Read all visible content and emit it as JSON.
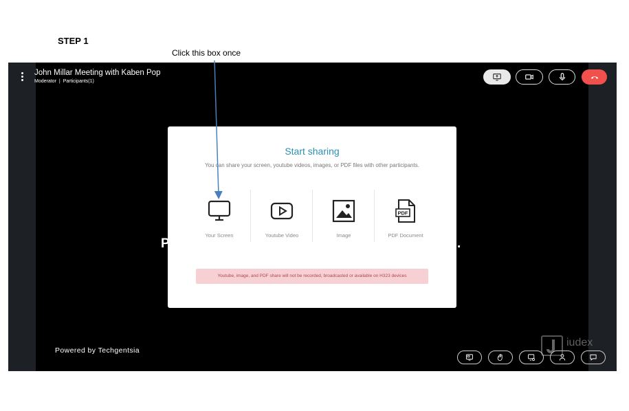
{
  "page": {
    "step_title": "STEP 1",
    "annotation": "Click this box once"
  },
  "meeting": {
    "title": "John Millar Meeting with Kaben Pop",
    "role": "Moderator",
    "separator": "|",
    "participants": "Participants(1)",
    "powered_by": "Powered by Techgentsia",
    "brand": "iudex",
    "behind_text_left": "P",
    "behind_text_right": "."
  },
  "top_controls": [
    {
      "name": "share-screen",
      "icon": "screen-share-icon"
    },
    {
      "name": "video",
      "icon": "video-camera-icon"
    },
    {
      "name": "microphone",
      "icon": "microphone-icon"
    },
    {
      "name": "end-call",
      "icon": "phone-hangup-icon"
    }
  ],
  "bottom_controls": [
    {
      "name": "layout",
      "icon": "layout-icon"
    },
    {
      "name": "raise-hand",
      "icon": "hand-icon"
    },
    {
      "name": "screen-settings",
      "icon": "screen-settings-icon"
    },
    {
      "name": "participants",
      "icon": "participants-icon"
    },
    {
      "name": "chat",
      "icon": "chat-icon"
    }
  ],
  "modal": {
    "title": "Start sharing",
    "description": "You can share your screen, youtube videos, images, or PDF files with other participants.",
    "options": [
      {
        "label": "Your Screen",
        "icon": "monitor-icon"
      },
      {
        "label": "Youtube Video",
        "icon": "play-button-icon"
      },
      {
        "label": "Image",
        "icon": "image-icon"
      },
      {
        "label": "PDF Document",
        "icon": "pdf-file-icon"
      }
    ],
    "pdf_icon_text": "PDF",
    "warning": "Youtube, image, and PDF share will not be recorded, broadcasted or available on H323 devices"
  },
  "colors": {
    "accent": "#2b8fb3",
    "end_call": "#f2504d",
    "warning_bg": "#f6d0d3",
    "warning_text": "#b04650",
    "arrow": "#4a7fbf"
  }
}
